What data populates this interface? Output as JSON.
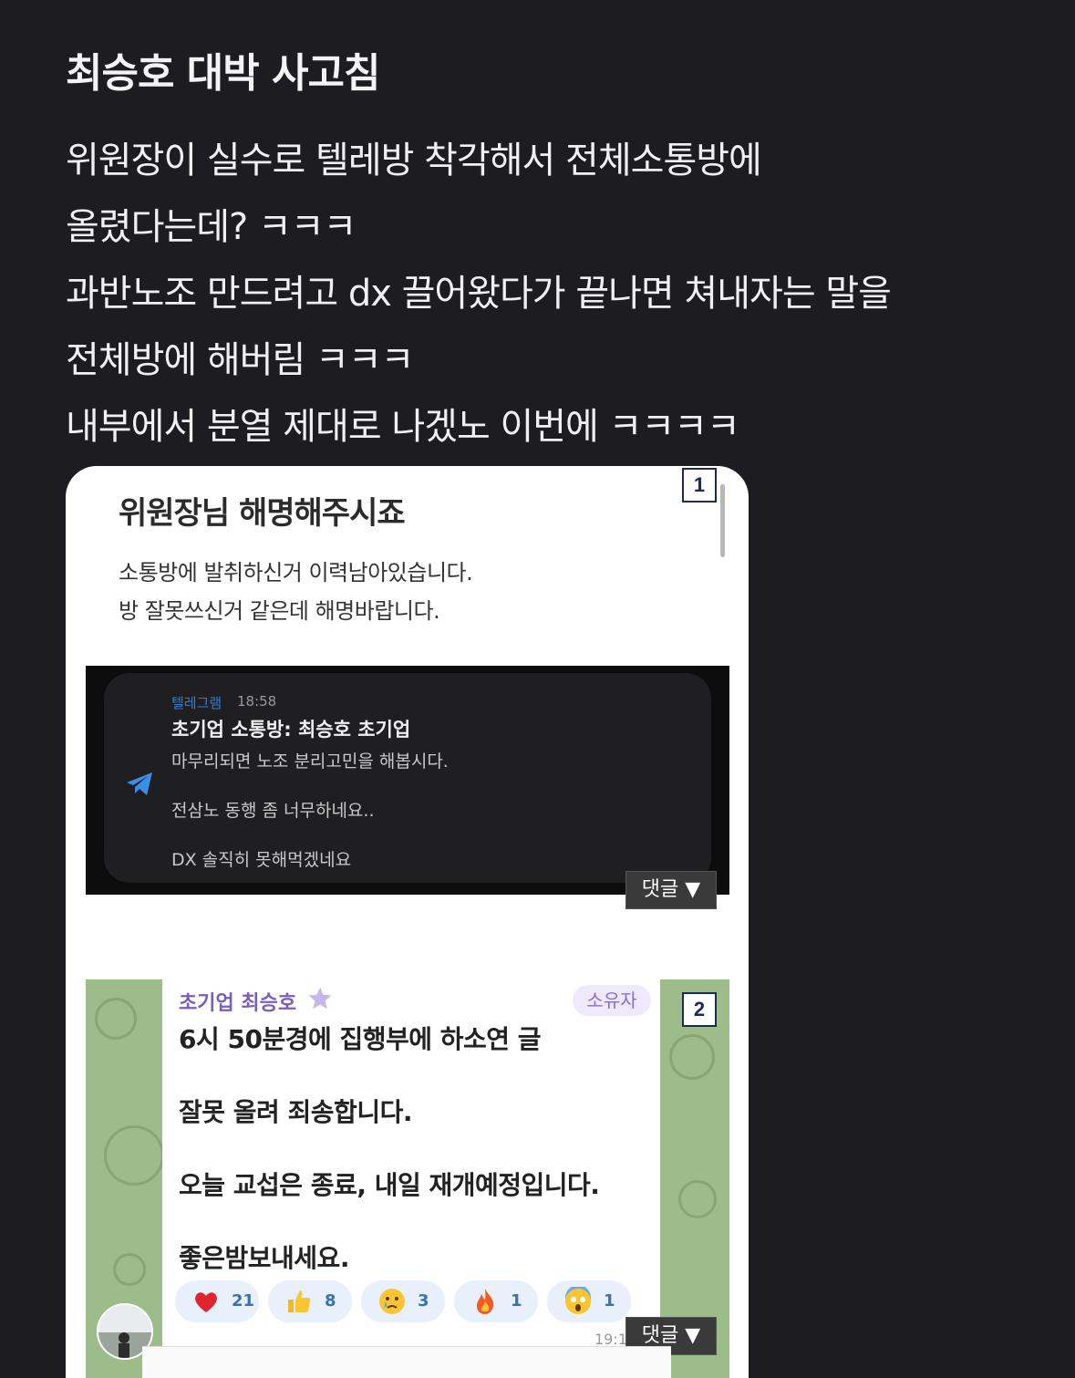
{
  "post": {
    "title": "최승호 대박 사고침",
    "body_lines": [
      "위원장이 실수로 텔레방 착각해서 전체소통방에",
      "올렸다는데? ㅋㅋㅋ",
      "과반노조 만드려고 dx 끌어왔다가 끝나면 쳐내자는 말을",
      "전체방에 해버림 ㅋㅋㅋ",
      "내부에서 분열 제대로 나겠노 이번에 ㅋㅋㅋㅋ"
    ]
  },
  "card": {
    "badge1": "1",
    "badge2": "2",
    "question_title": "위원장님 해명해주시죠",
    "question_lines": [
      "소통방에 발취하신거 이력남아있습니다.",
      "방 잘못쓰신거 같은데 해명바랍니다."
    ],
    "telegram": {
      "app_name": "텔레그램",
      "time": "18:58",
      "sender": "초기업 소통방: 최승호 초기업",
      "lines": [
        "마무리되면 노조 분리고민을 해봅시다.",
        "전삼노 동행 좀 너무하네요..",
        "DX 솔직히 못해먹겠네요"
      ]
    },
    "comment_button": "댓글 ▼",
    "chat": {
      "sender": "초기업 최승호",
      "owner_tag": "소유자",
      "lines": [
        "6시 50분경에 집행부에 하소연 글",
        "잘못 올려 죄송합니다.",
        "오늘 교섭은 종료, 내일 재개예정입니다.",
        "좋은밤보내세요."
      ],
      "reactions": [
        {
          "icon": "heart-icon",
          "count": "21"
        },
        {
          "icon": "thumbs-up-icon",
          "count": "8"
        },
        {
          "icon": "crying-face-icon",
          "count": "3"
        },
        {
          "icon": "fire-icon",
          "count": "1"
        },
        {
          "icon": "screaming-face-icon",
          "count": "1"
        }
      ],
      "time": "19:1",
      "comment_button": "댓글 ▼"
    }
  }
}
